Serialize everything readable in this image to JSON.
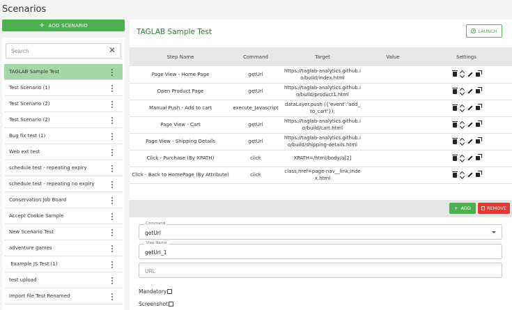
{
  "page_title": "Scenarios",
  "add_scenario_label": "ADD SCENARIO",
  "search": {
    "placeholder": "Search"
  },
  "scenarios": [
    "TAGLAB Sample Test",
    "Test Scenario (1)",
    "Test Scenario (2)",
    "Test Scenario (2)",
    "Bug fix test (1)",
    "Web ext test",
    "schedule test - repeating expiry",
    "schedule test - repeating no expiry",
    "Conservation Job Board",
    "Accept Cookie Sample",
    "New Scenario Test",
    "adventure games",
    " Example JS Test (1)",
    "test upload",
    "Import file Test Renamed"
  ],
  "main": {
    "title": "TAGLAB Sample Test",
    "launch_label": "LAUNCH",
    "columns": [
      "Step Name",
      "Command",
      "Target",
      "Value",
      "Settings"
    ],
    "rows": [
      {
        "step": "Page View - Home Page",
        "command": "getUrl",
        "target": "https://taglab-analytics.github.io/build/index.html",
        "value": ""
      },
      {
        "step": "Open Product Page",
        "command": "getUrl",
        "target": "https://taglab-analytics.github.io/build/product1.html",
        "value": ""
      },
      {
        "step": "Manual Push - Add to cart",
        "command": "execute_Javascript",
        "target": "dataLayer.push ({'event':'add_to_cart'});",
        "value": ""
      },
      {
        "step": "Page View - Cart",
        "command": "getUrl",
        "target": "https://taglab-analytics.github.io/build/cart.html",
        "value": ""
      },
      {
        "step": "Page View - Shipping Details",
        "command": "getUrl",
        "target": "https://taglab-analytics.github.io/build/shipping-details.html",
        "value": ""
      },
      {
        "step": "Click - Purchase (By XPATH)",
        "command": "click",
        "target": "XPATH=/html/body/a[2]",
        "value": ""
      },
      {
        "step": "Click - Back to HomePage (By Attribute)",
        "command": "click",
        "target": "class;href=page-nav__link;index.html",
        "value": ""
      }
    ],
    "add_label": "ADD",
    "remove_label": "REMOVE",
    "form": {
      "command_label": "Command",
      "command_value": "getUrl",
      "stepname_label": "Step Name",
      "stepname_value": "getUrl_1",
      "url_placeholder": "URL",
      "mandatory_label": "Mandatory",
      "screenshot_label": "Screenshot"
    }
  },
  "colors": {
    "green": "#4caf50",
    "active_row": "#a5d6a7",
    "red": "#e53935",
    "title_green": "#2e7d32"
  }
}
